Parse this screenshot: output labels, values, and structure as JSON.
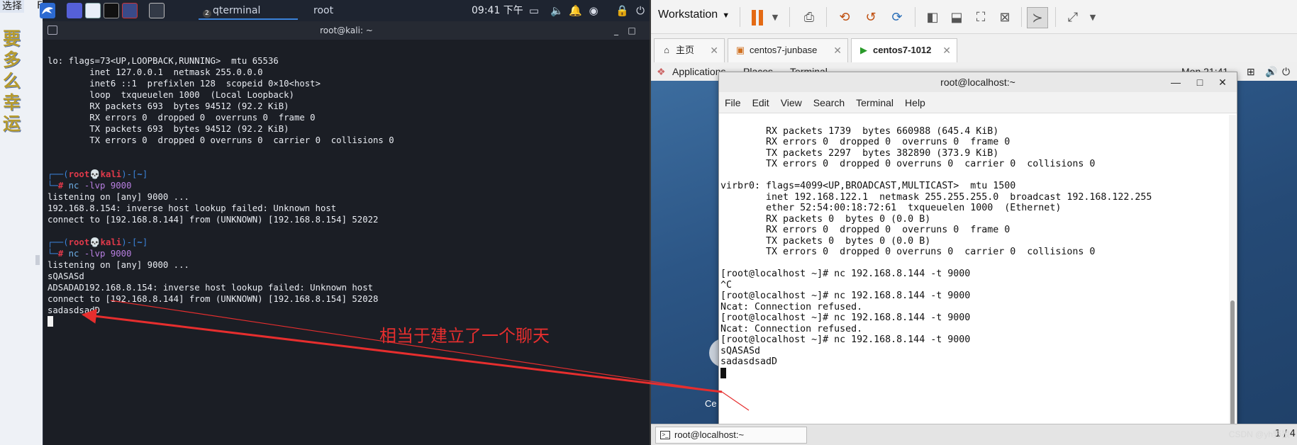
{
  "left_strip": {
    "top_label": "选择",
    "top_label2": "F",
    "vertical_text": "要多么幸运"
  },
  "kali_panel": {
    "tasks": [
      "qterminal",
      "root"
    ],
    "task_badge": "2",
    "clock": "09:41 下午"
  },
  "kali_terminal": {
    "title": "root@kali: ~",
    "ifconfig_lines": [
      "lo: flags=73<UP,LOOPBACK,RUNNING>  mtu 65536",
      "        inet 127.0.0.1  netmask 255.0.0.0",
      "        inet6 ::1  prefixlen 128  scopeid 0×10<host>",
      "        loop  txqueuelen 1000  (Local Loopback)",
      "        RX packets 693  bytes 94512 (92.2 KiB)",
      "        RX errors 0  dropped 0  overruns 0  frame 0",
      "        TX packets 693  bytes 94512 (92.2 KiB)",
      "        TX errors 0  dropped 0 overruns 0  carrier 0  collisions 0"
    ],
    "prompt": {
      "user": "root",
      "skull": "💀",
      "host": "kali",
      "dir": "~",
      "hash": "#",
      "open": "┌──(",
      "close": ")-[",
      "end": "]",
      "corner": "└─"
    },
    "session1": {
      "cmd": "nc",
      "args": "-lvp 9000",
      "output": [
        "listening on [any] 9000 ...",
        "192.168.8.154: inverse host lookup failed: Unknown host",
        "connect to [192.168.8.144] from (UNKNOWN) [192.168.8.154] 52022"
      ]
    },
    "session2": {
      "cmd": "nc",
      "args": "-lvp 9000",
      "output": [
        "listening on [any] 9000 ...",
        "sQASASd",
        "ADSADAD192.168.8.154: inverse host lookup failed: Unknown host",
        "connect to [192.168.8.144] from (UNKNOWN) [192.168.8.154] 52028",
        "sadasdsadD"
      ]
    }
  },
  "vmware": {
    "menu_label": "Workstation",
    "tabs": [
      {
        "label": "主页",
        "icon": "home-icon"
      },
      {
        "label": "centos7-junbase",
        "icon": "vm-icon"
      },
      {
        "label": "centos7-1012",
        "icon": "vm-running-icon"
      }
    ],
    "gnome_bar": {
      "applications": "Applications",
      "places": "Places",
      "terminal": "Terminal",
      "clock": "Mon 21:41"
    },
    "centos_terminal": {
      "title": "root@localhost:~",
      "menu": [
        "File",
        "Edit",
        "View",
        "Search",
        "Terminal",
        "Help"
      ],
      "lines": [
        "        RX packets 1739  bytes 660988 (645.4 KiB)",
        "        RX errors 0  dropped 0  overruns 0  frame 0",
        "        TX packets 2297  bytes 382890 (373.9 KiB)",
        "        TX errors 0  dropped 0 overruns 0  carrier 0  collisions 0",
        "",
        "virbr0: flags=4099<UP,BROADCAST,MULTICAST>  mtu 1500",
        "        inet 192.168.122.1  netmask 255.255.255.0  broadcast 192.168.122.255",
        "        ether 52:54:00:18:72:61  txqueuelen 1000  (Ethernet)",
        "        RX packets 0  bytes 0 (0.0 B)",
        "        RX errors 0  dropped 0  overruns 0  frame 0",
        "        TX packets 0  bytes 0 (0.0 B)",
        "        TX errors 0  dropped 0 overruns 0  carrier 0  collisions 0",
        "",
        "[root@localhost ~]# nc 192.168.8.144 -t 9000",
        "^C",
        "[root@localhost ~]# nc 192.168.8.144 -t 9000",
        "Ncat: Connection refused.",
        "[root@localhost ~]# nc 192.168.8.144 -t 9000",
        "Ncat: Connection refused.",
        "[root@localhost ~]# nc 192.168.8.144 -t 9000",
        "sQASASd",
        "sadasdsadD"
      ]
    },
    "desktop_label": "Ce",
    "taskbar_item": "root@localhost:~",
    "page_indicator": "1 / 4"
  },
  "annotation": {
    "text": "相当于建立了一个聊天",
    "color": "#e62e2e"
  },
  "watermark": "CSDN @yh野狼"
}
